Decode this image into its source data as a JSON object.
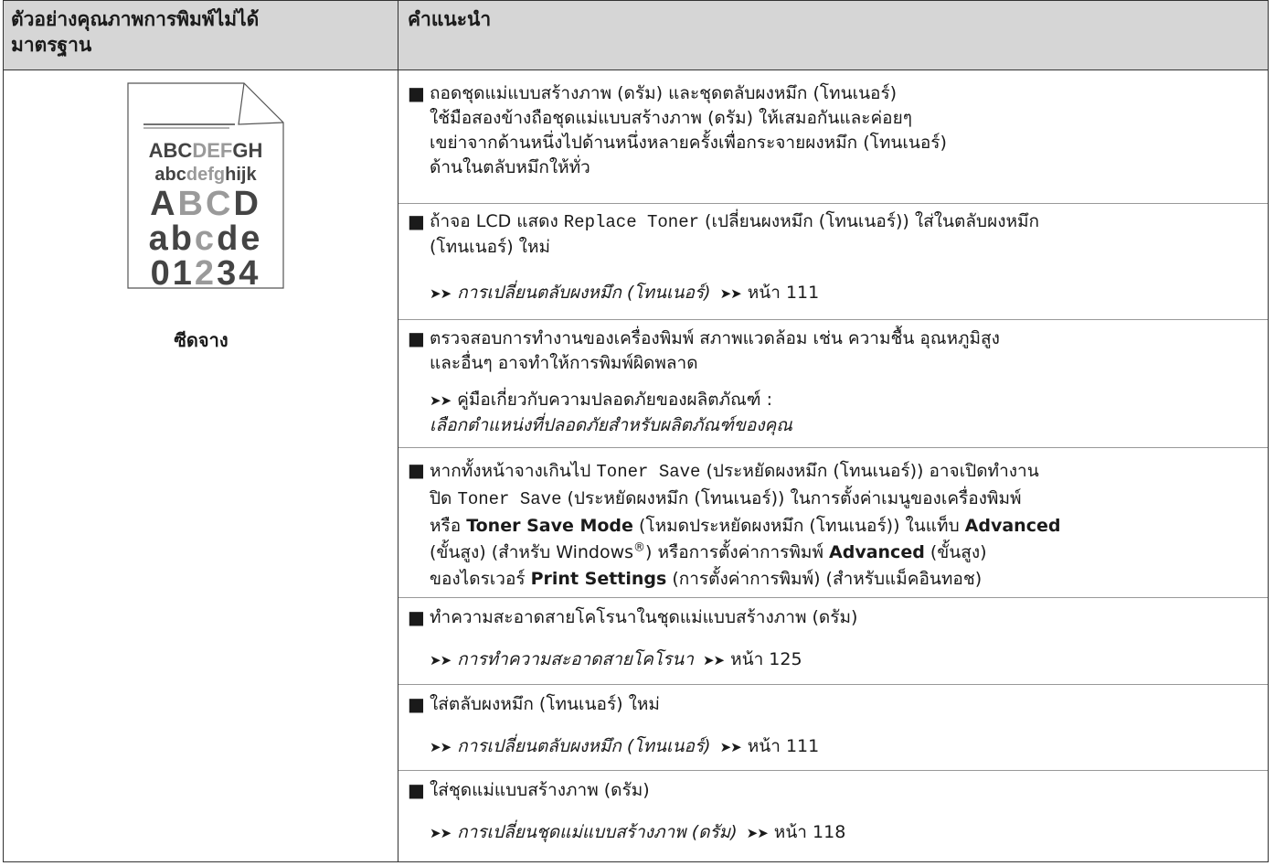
{
  "header": {
    "col1_line1": "ตัวอย่างคุณภาพการพิมพ์ไม่ได้",
    "col1_line2": "มาตรฐาน",
    "col2": "คำแนะนำ"
  },
  "sample": {
    "line1_a": "ABC",
    "line1_b": "DEF",
    "line1_c": "GH",
    "line2_a": "abc",
    "line2_b": "defg",
    "line2_c": "hijk",
    "line3_a": "A",
    "line3_b": "B",
    "line3_c": "C",
    "line3_d": "D",
    "line4_a": "ab",
    "line4_b": "c",
    "line4_c": "de",
    "line5_a": "01",
    "line5_b": "2",
    "line5_c": "34",
    "caption": "ซีดจาง",
    "faded_color": "#9a9a9a",
    "dark_color": "#444444"
  },
  "tips": {
    "t1": {
      "l1": "ถอดชุดแม่แบบสร้างภาพ (ดรัม) และชุดตลับผงหมึก (โทนเนอร์)",
      "l2": "ใช้มือสองข้างถือชุดแม่แบบสร้างภาพ (ดรัม) ให้เสมอกันและค่อยๆ",
      "l3": "เขย่าจากด้านหนึ่งไปด้านหนึ่งหลายครั้งเพื่อกระจายผงหมึก (โทนเนอร์)",
      "l4": "ด้านในตลับหมึกให้ทั่ว"
    },
    "t2": {
      "l1_a": "ถ้าจอ LCD แสดง ",
      "l1_code": "Replace Toner",
      "l1_b": " (เปลี่ยนผงหมึก (โทนเนอร์)) ใส่ในตลับผงหมึก",
      "l2": "(โทนเนอร์) ใหม่",
      "ref_link": "การเปลี่ยนตลับผงหมึก (โทนเนอร์)",
      "ref_page": "หน้า 111"
    },
    "t3": {
      "l1": "ตรวจสอบการทำงานของเครื่องพิมพ์ สภาพแวดล้อม เช่น ความชื้น อุณหภูมิสูง",
      "l2": "และอื่นๆ อาจทำให้การพิมพ์ผิดพลาด",
      "ref_l1": "คู่มือเกี่ยวกับความปลอดภัยของผลิตภัณฑ์ :",
      "ref_l2": "เลือกตำแหน่งที่ปลอดภัยสำหรับผลิตภัณฑ์ของคุณ"
    },
    "t4": {
      "l1_a": "หากทั้งหน้าจางเกินไป ",
      "l1_code": "Toner Save",
      "l1_b": " (ประหยัดผงหมึก (โทนเนอร์)) อาจเปิดทำงาน",
      "l2_a": "ปิด ",
      "l2_code": "Toner Save",
      "l2_b": " (ประหยัดผงหมึก (โทนเนอร์)) ในการตั้งค่าเมนูของเครื่องพิมพ์",
      "l3_a": "หรือ ",
      "l3_bold1": "Toner Save Mode",
      "l3_b": " (โหมดประหยัดผงหมึก (โทนเนอร์)) ในแท็บ ",
      "l3_bold2": "Advanced",
      "l4_a": "(ขั้นสูง) (สำหรับ Windows",
      "l4_sup": "®",
      "l4_b": ") หรือการตั้งค่าการพิมพ์ ",
      "l4_bold": "Advanced",
      "l4_c": " (ขั้นสูง)",
      "l5_a": "ของไดรเวอร์ ",
      "l5_bold": "Print Settings",
      "l5_b": " (การตั้งค่าการพิมพ์) (สำหรับแม็คอินทอช)"
    },
    "t5": {
      "l1": "ทำความสะอาดสายโคโรนาในชุดแม่แบบสร้างภาพ (ดรัม)",
      "ref_link": "การทำความสะอาดสายโคโรนา",
      "ref_page": "หน้า 125"
    },
    "t6": {
      "l1": "ใส่ตลับผงหมึก (โทนเนอร์) ใหม่",
      "ref_link": "การเปลี่ยนตลับผงหมึก (โทนเนอร์)",
      "ref_page": "หน้า 111"
    },
    "t7": {
      "l1": "ใส่ชุดแม่แบบสร้างภาพ (ดรัม)",
      "ref_link": "การเปลี่ยนชุดแม่แบบสร้างภาพ (ดรัม)",
      "ref_page": "หน้า 118"
    }
  },
  "icons": {
    "bullet": "square-bullet-icon",
    "arrow": "double-arrow-icon"
  },
  "glyphs": {
    "bullet": "■",
    "arrow": "➤➤"
  }
}
